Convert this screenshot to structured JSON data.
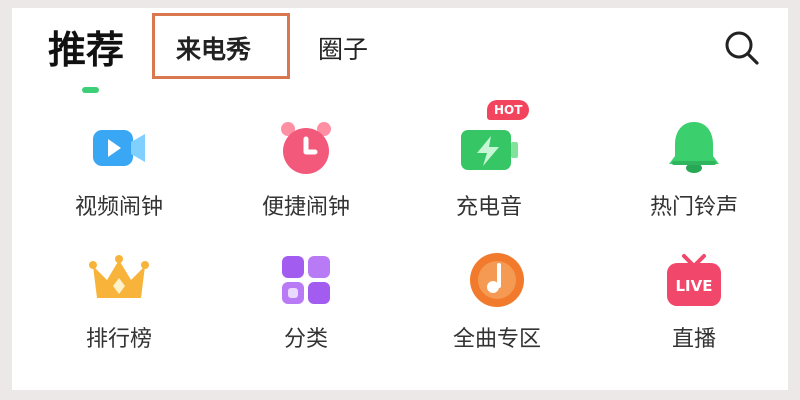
{
  "header": {
    "title": "推荐",
    "tabs": [
      {
        "label": "来电秀"
      },
      {
        "label": "圈子"
      }
    ],
    "search_icon": "search-icon"
  },
  "grid": {
    "items": [
      {
        "label": "视频闹钟",
        "icon": "video-camera-icon",
        "color": "#3aa7f5"
      },
      {
        "label": "便捷闹钟",
        "icon": "alarm-clock-icon",
        "color": "#f2597a"
      },
      {
        "label": "充电音",
        "icon": "battery-charging-icon",
        "color": "#36c665",
        "badge": "HOT"
      },
      {
        "label": "热门铃声",
        "icon": "bell-icon",
        "color": "#3ccf6e"
      },
      {
        "label": "排行榜",
        "icon": "crown-icon",
        "color": "#f8b43a"
      },
      {
        "label": "分类",
        "icon": "category-grid-icon",
        "color": "#a25cf0"
      },
      {
        "label": "全曲专区",
        "icon": "music-note-icon",
        "color": "#f27a2c"
      },
      {
        "label": "直播",
        "icon": "live-tv-icon",
        "color": "#f0476a",
        "icon_text": "LIVE"
      }
    ]
  },
  "colors": {
    "accent": "#3dcf78",
    "highlight_box": "#d9774f",
    "badge": "#f2455d"
  }
}
